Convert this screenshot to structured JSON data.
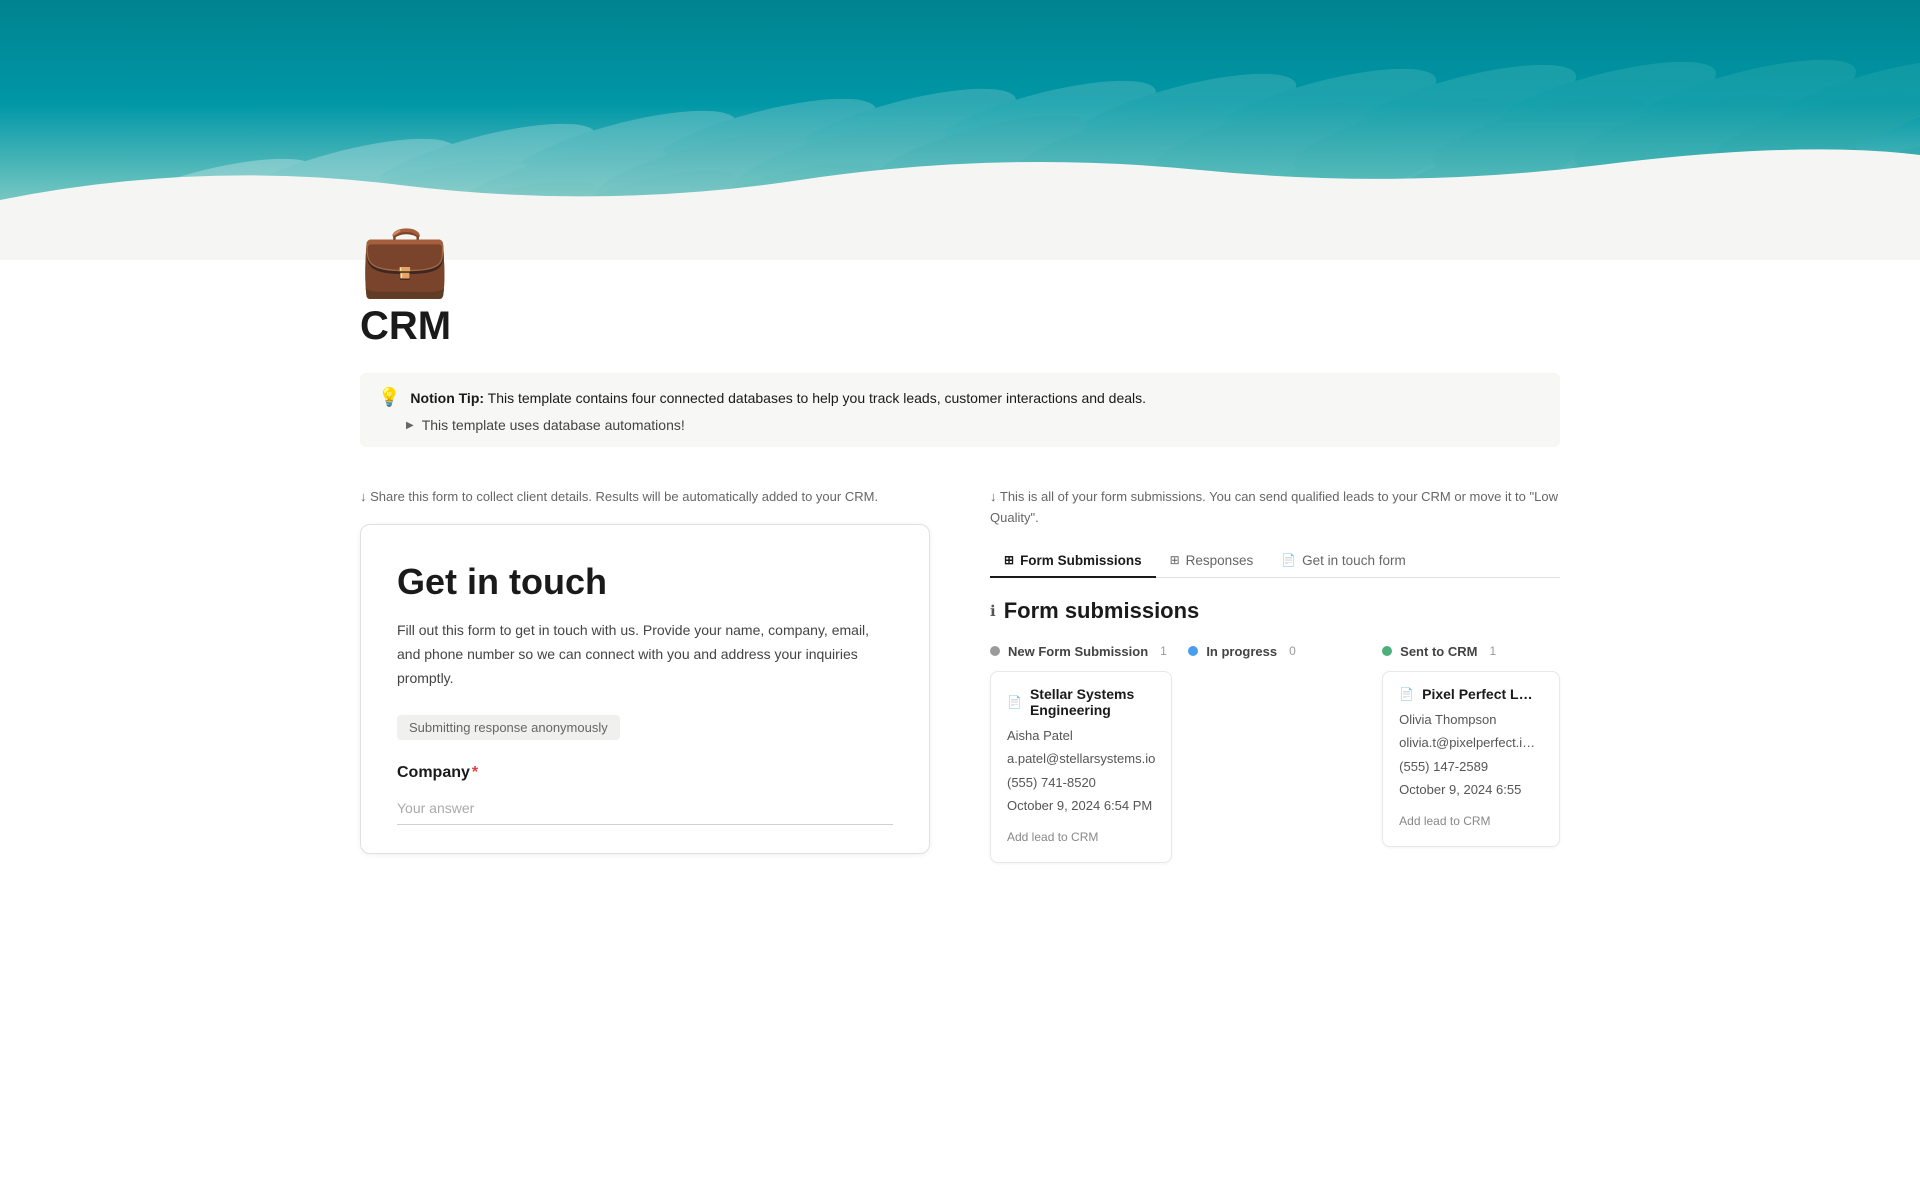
{
  "cover": {
    "alt": "Abstract architectural wave pattern"
  },
  "page": {
    "icon": "💼",
    "title": "CRM"
  },
  "callout": {
    "icon": "💡",
    "bold_label": "Notion Tip:",
    "text": " This template contains four connected databases to help you track leads, customer interactions and deals.",
    "toggle_label": "This template uses database automations!"
  },
  "left_col": {
    "desc": "↓ Share this form to collect client details. Results will be automatically added to your CRM.",
    "form": {
      "title": "Get in touch",
      "description": "Fill out this form to get in touch with us. Provide your name, company, email, and phone number so we can connect with you and address your inquiries promptly.",
      "anon_label": "Submitting response anonymously",
      "field_label": "Company",
      "field_required": "*",
      "field_placeholder": "Your answer"
    }
  },
  "right_col": {
    "desc": "↓ This is all of your form submissions. You can send qualified leads to your CRM or move it to \"Low Quality\".",
    "tabs": [
      {
        "label": "Form Submissions",
        "icon": "⊞",
        "active": true
      },
      {
        "label": "Responses",
        "icon": "⊞",
        "active": false
      },
      {
        "label": "Get in touch form",
        "icon": "📄",
        "active": false
      }
    ],
    "section_icon": "ℹ",
    "section_title": "Form submissions",
    "columns": [
      {
        "label": "New Form Submission",
        "dot_color": "#9b9b9b",
        "count": "1",
        "cards": [
          {
            "company": "Stellar Systems Engineering",
            "company_icon": "📄",
            "fields": [
              "Aisha Patel",
              "a.patel@stellarsystems.io",
              "(555) 741-8520",
              "October 9, 2024 6:54 PM"
            ],
            "add_btn": "Add lead to CRM"
          }
        ]
      },
      {
        "label": "In progress",
        "dot_color": "#4a9ced",
        "count": "0",
        "cards": []
      },
      {
        "label": "Sent to CRM",
        "dot_color": "#4caf7d",
        "count": "1",
        "cards": [
          {
            "company": "Pixel Perfect L…",
            "company_icon": "📄",
            "fields": [
              "Olivia Thompson",
              "olivia.t@pixelperfect.i…",
              "(555) 147-2589",
              "October 9, 2024 6:55"
            ],
            "add_btn": "Add lead to CRM"
          }
        ]
      }
    ]
  }
}
